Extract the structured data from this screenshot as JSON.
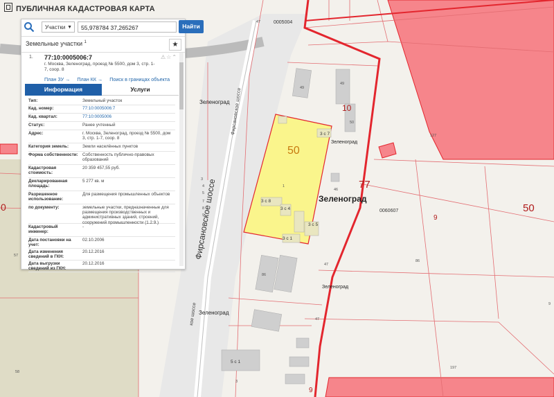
{
  "app": {
    "title": "ПУБЛИЧНАЯ КАДАСТРОВАЯ КАРТА"
  },
  "search": {
    "type_label": "Участки",
    "query": "55,978784 37,265267",
    "find_label": "Найти"
  },
  "panel": {
    "section_title": "Земельные участки",
    "section_count": "1",
    "record": {
      "index": "1.",
      "cadastral_number": "77:10:0005006:7",
      "address": "г. Москва, Зеленоград, проезд № 5500, дом 3, стр. 1-7, соор. 8",
      "links": [
        "План ЗУ →",
        "План КК →",
        "Поиск в границах объекта →"
      ]
    },
    "tabs": [
      "Информация",
      "Услуги"
    ],
    "fields": [
      {
        "k": "Тип:",
        "v": "Земельный участок",
        "link": false
      },
      {
        "k": "Кад. номер:",
        "v": "77:10:0005006:7",
        "link": true
      },
      {
        "k": "Кад. квартал:",
        "v": "77:10:0005006",
        "link": true
      },
      {
        "k": "Статус:",
        "v": "Ранее учтенный",
        "link": false
      },
      {
        "k": "Адрес:",
        "v": "г. Москва, Зеленоград, проезд № 5500, дом 3, стр. 1-7, соор. 8",
        "link": false
      },
      {
        "k": "Категория земель:",
        "v": "Земли населённых пунктов",
        "link": false
      },
      {
        "k": "Форма собственности:",
        "v": "Собственность публично-правовых образований",
        "link": false
      },
      {
        "k": "Кадастровая стоимость:",
        "v": "20 359 457,55 руб.",
        "link": false
      },
      {
        "k": "Декларированная площадь:",
        "v": "5 277 кв. м",
        "link": false
      },
      {
        "k": "Разрешенное использование:",
        "v": "Для размещения промышленных объектов",
        "link": false
      },
      {
        "k": "по документу:",
        "v": "земельные участки, предназначенные для размещения производственных и административных зданий, строений, сооружений промышленности (1.2.9.)",
        "link": false
      },
      {
        "k": "Кадастровый инженер:",
        "v": "-",
        "link": false
      },
      {
        "k": "Дата постановки на учет:",
        "v": "02.10.2006",
        "link": false
      },
      {
        "k": "Дата изменения сведений в ГКН:",
        "v": "20.12.2016",
        "link": false
      },
      {
        "k": "Дата выгрузки сведений из ГКН:",
        "v": "20.12.2016",
        "link": false
      }
    ]
  },
  "map": {
    "road_name_main": "Фирсановское шоссе",
    "road_name_top": "Фирсановское шоссе",
    "road_name_lower": "кое шоссе",
    "place_labels": {
      "a": "Зеленоград",
      "b": "Зеленоград",
      "c": "Зеленоград",
      "d": "Зеленоград",
      "e": "Зеленоград"
    },
    "district_numbers": {
      "big50": "50",
      "big77": "77",
      "big50b": "50",
      "n10": "10",
      "n9": "9",
      "n9b": "9",
      "n0": "0"
    },
    "block_code_top": "0005004",
    "block_code_right": "0060607",
    "building_labels": {
      "b1": "3 с 8",
      "b2": "3 с 4",
      "b3": "3 с 5",
      "b4": "3 с 1",
      "b5": "3 с 7",
      "b6": "5 с 1"
    },
    "small_numbers": {
      "a": "49",
      "b": "49",
      "c": "46",
      "d": "47",
      "e": "47",
      "f": "86",
      "g": "127",
      "h": "197",
      "i": "57",
      "j": "58",
      "k": "3",
      "l": "1",
      "m": "50",
      "n": "47",
      "o": "9",
      "p": "86",
      "q": "3",
      "r": "4",
      "s": "5",
      "t": "7",
      "u": "8",
      "v": "9"
    },
    "colors": {
      "parcel_highlight": "#faf58c",
      "parcel_red_fill": "#f6858b",
      "boundary_red": "#e3262e",
      "thin_boundary": "#e36d72",
      "building": "#cfcfcf"
    }
  }
}
